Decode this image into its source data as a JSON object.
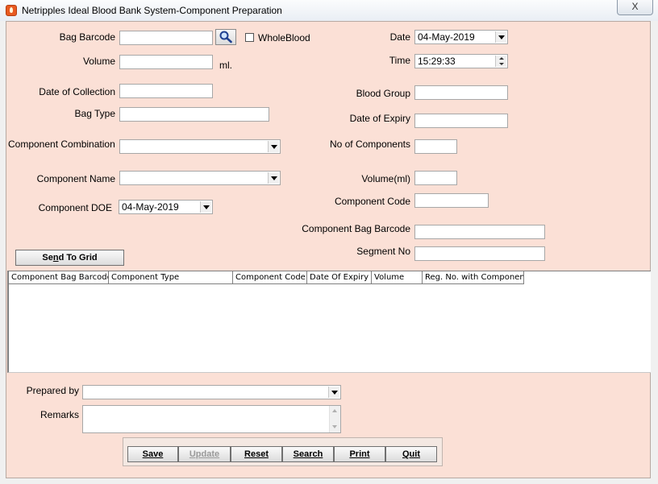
{
  "window": {
    "title": "Netripples Ideal Blood Bank System-Component Preparation",
    "close_label": "X",
    "icon": "app-drop-icon"
  },
  "form": {
    "bag_barcode_label": "Bag Barcode",
    "bag_barcode_value": "",
    "search_icon": "magnifier-icon",
    "wholeblood_label": "WholeBlood",
    "wholeblood_checked": false,
    "volume_label": "Volume",
    "volume_value": "",
    "volume_unit": "ml.",
    "date_label": "Date",
    "date_value": "04-May-2019",
    "time_label": "Time",
    "time_value": "15:29:33",
    "date_of_collection_label": "Date of Collection",
    "date_of_collection_value": "",
    "blood_group_label": "Blood Group",
    "blood_group_value": "",
    "bag_type_label": "Bag Type",
    "bag_type_value": "",
    "date_of_expiry_label": "Date of Expiry",
    "date_of_expiry_value": "",
    "component_combination_label": "Component Combination",
    "component_combination_value": "",
    "no_of_components_label": "No of Components",
    "no_of_components_value": "",
    "component_name_label": "Component Name",
    "component_name_value": "",
    "volume_ml_label": "Volume(ml)",
    "volume_ml_value": "",
    "component_code_label": "Component Code",
    "component_code_value": "",
    "component_doe_label": "Component DOE",
    "component_doe_value": "04-May-2019",
    "component_bag_barcode_label": "Component Bag Barcode",
    "component_bag_barcode_value": "",
    "segment_no_label": "Segment No",
    "segment_no_value": "",
    "send_to_grid_label_pre": "Se",
    "send_to_grid_label_u": "n",
    "send_to_grid_label_post": "d To Grid"
  },
  "grid": {
    "columns": [
      "Component Bag Barcode",
      "Component Type",
      "Component Code",
      "Date Of Expiry",
      "Volume",
      "Reg. No. with Component"
    ],
    "rows": []
  },
  "footer": {
    "prepared_by_label": "Prepared by",
    "prepared_by_value": "",
    "remarks_label": "Remarks",
    "remarks_value": ""
  },
  "buttons": {
    "save": "Save",
    "update": "Update",
    "reset": "Reset",
    "search": "Search",
    "print": "Print",
    "quit": "Quit"
  },
  "colors": {
    "form_background": "#fbe0d6",
    "window_background": "#f0f0f0",
    "disabled_text": "#9a9a9a"
  }
}
